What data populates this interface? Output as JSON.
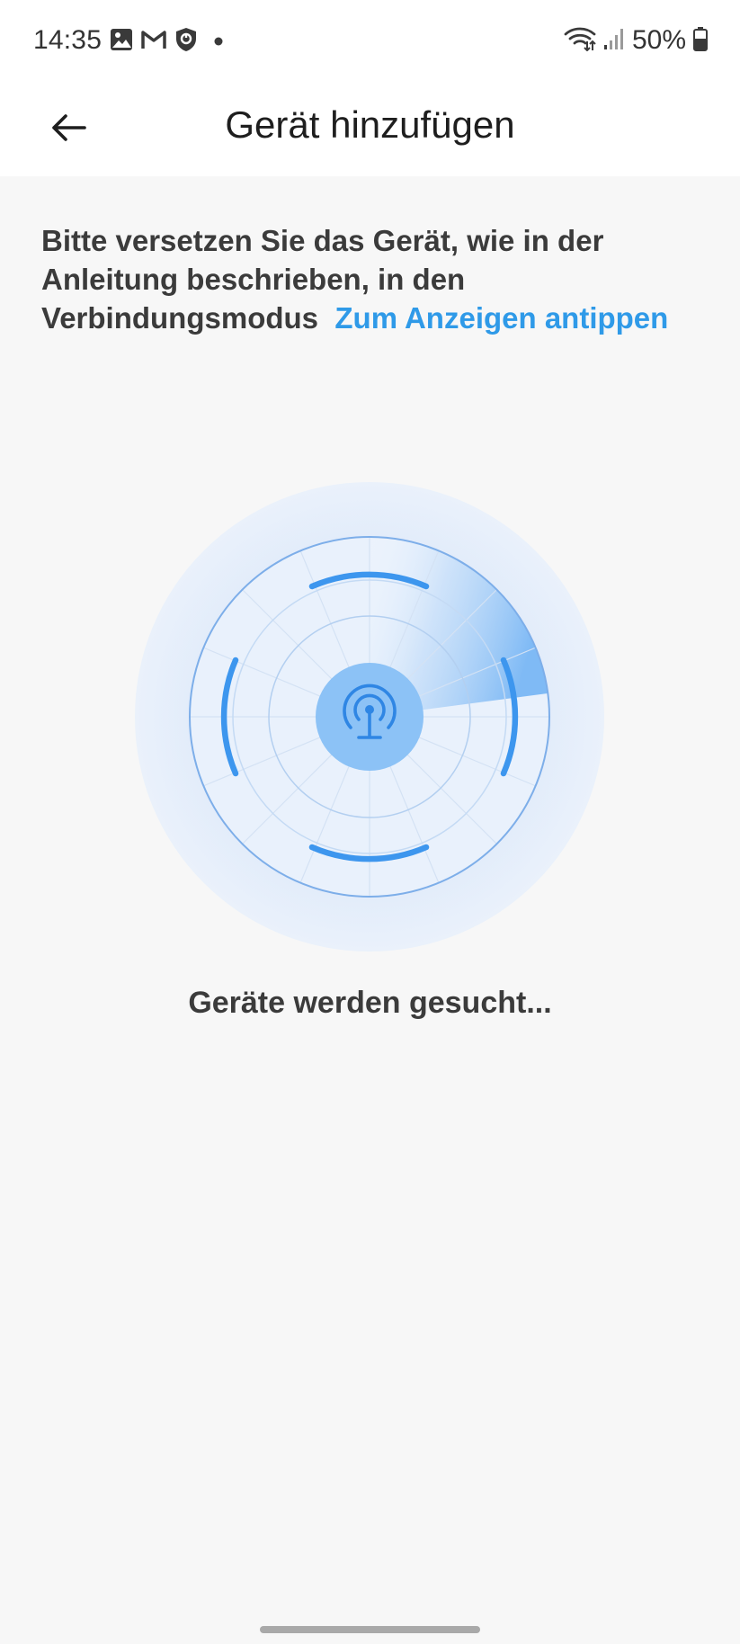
{
  "status_bar": {
    "time": "14:35",
    "battery": "50%",
    "left_icons": [
      "gallery-icon",
      "gmail-icon",
      "shield-icon",
      "dot-icon"
    ],
    "right_icons": [
      "wifi-icon",
      "signal-icon",
      "battery-icon"
    ]
  },
  "header": {
    "title": "Gerät hinzufügen",
    "back_icon": "arrow-left-icon"
  },
  "main": {
    "instruction": "Bitte versetzen Sie das Gerät, wie in der Anleitung beschrieben, in den Verbindungsmodus",
    "instruction_link": "Zum Anzeigen antippen",
    "radar_icon": "antenna-icon",
    "status_text": "Geräte werden gesucht..."
  },
  "colors": {
    "accent": "#2f9ae8",
    "radar_blue": "#4a9ff0",
    "background": "#f7f7f7"
  }
}
